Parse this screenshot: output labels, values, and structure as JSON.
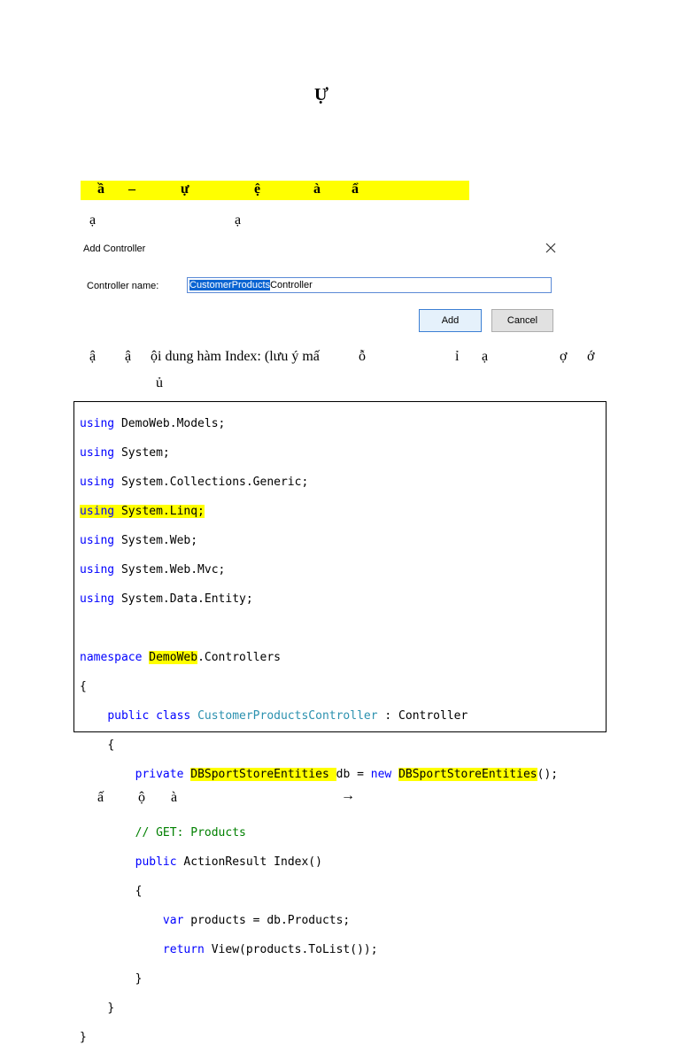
{
  "heading": "Ự",
  "highlight_line": [
    "ầ",
    "–",
    "ự",
    "ệ",
    "à",
    "ẩ"
  ],
  "line2": [
    "ạ",
    "ạ"
  ],
  "dialog": {
    "title": "Add Controller",
    "field_label": "Controller name:",
    "field_selected": "CustomerProducts",
    "field_rest": "Controller",
    "add_label": "Add",
    "cancel_label": "Cancel"
  },
  "paragraph": {
    "line1": [
      "ậ",
      "ậ",
      "ội dung hàm Index: (lưu ý mấ",
      "ỗ",
      "ỉ",
      "ạ",
      "ợ",
      "ớ"
    ],
    "line2": [
      "ủ"
    ]
  },
  "code": {
    "l1_kw": "using",
    "l1_rest": " DemoWeb.Models;",
    "l2_kw": "using",
    "l2_rest": " System;",
    "l3_kw": "using",
    "l3_rest": " System.Collections.Generic;",
    "l4_kw": "using",
    "l4_rest": " System.Linq;",
    "l5_kw": "using",
    "l5_rest": " System.Web;",
    "l6_kw": "using",
    "l6_rest": " System.Web.Mvc;",
    "l7_kw": "using",
    "l7_rest": " System.Data.Entity;",
    "ns_kw": "namespace",
    "ns_name": "DemoWeb",
    "ns_rest": ".Controllers",
    "open1": "{",
    "cls_kw": "public class",
    "cls_name": "CustomerProductsController",
    "cls_rest": " : Controller",
    "open2": "{",
    "priv_kw": "private",
    "priv_type": "DBSportStoreEntities ",
    "priv_mid": "db = ",
    "priv_new": "new",
    "priv_type2": "DBSportStoreEntities",
    "priv_end": "();",
    "comment": "// GET: Products",
    "pub_kw": "public",
    "pub_rest": " ActionResult Index()",
    "open3": "{",
    "var_kw": "var",
    "var_rest": " products = db.Products;",
    "ret_kw": "return",
    "ret_rest": " View(products.ToList());",
    "close3": "}",
    "close2": "}",
    "close1": "}"
  },
  "bottom": [
    "ấ",
    "ộ",
    "à",
    "→"
  ]
}
